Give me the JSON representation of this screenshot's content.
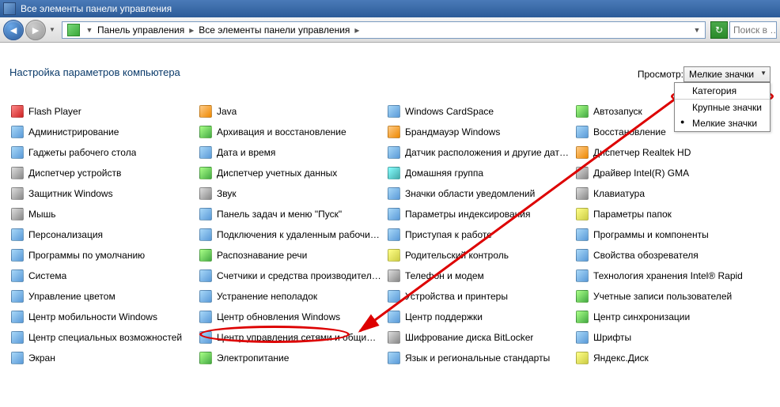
{
  "window": {
    "title": "Все элементы панели управления"
  },
  "toolbar": {
    "crumb1": "Панель управления",
    "crumb2": "Все элементы панели управления",
    "search_placeholder": "Поиск в …"
  },
  "page": {
    "title": "Настройка параметров компьютера",
    "view_label": "Просмотр:",
    "view_selected": "Мелкие значки"
  },
  "view_menu": {
    "opt1": "Категория",
    "opt2": "Крупные значки",
    "opt3": "Мелкие значки"
  },
  "items": [
    {
      "label": "Flash Player",
      "c": "c-red"
    },
    {
      "label": "Java",
      "c": "c-orange"
    },
    {
      "label": "Windows CardSpace",
      "c": ""
    },
    {
      "label": "Автозапуск",
      "c": "c-green"
    },
    {
      "label": "Администрирование",
      "c": ""
    },
    {
      "label": "Архивация и восстановление",
      "c": "c-green"
    },
    {
      "label": "Брандмауэр Windows",
      "c": "c-orange"
    },
    {
      "label": "Восстановление",
      "c": ""
    },
    {
      "label": "Гаджеты рабочего стола",
      "c": ""
    },
    {
      "label": "Дата и время",
      "c": ""
    },
    {
      "label": "Датчик расположения и другие датч…",
      "c": ""
    },
    {
      "label": "Диспетчер Realtek HD",
      "c": "c-orange"
    },
    {
      "label": "Диспетчер устройств",
      "c": "c-gray"
    },
    {
      "label": "Диспетчер учетных данных",
      "c": "c-green"
    },
    {
      "label": "Домашняя группа",
      "c": "c-teal"
    },
    {
      "label": "Драйвер Intel(R) GMA",
      "c": "c-gray"
    },
    {
      "label": "Защитник Windows",
      "c": "c-gray"
    },
    {
      "label": "Звук",
      "c": "c-gray"
    },
    {
      "label": "Значки области уведомлений",
      "c": ""
    },
    {
      "label": "Клавиатура",
      "c": "c-gray"
    },
    {
      "label": "Мышь",
      "c": "c-gray"
    },
    {
      "label": "Панель задач и меню \"Пуск\"",
      "c": ""
    },
    {
      "label": "Параметры индексирования",
      "c": ""
    },
    {
      "label": "Параметры папок",
      "c": "c-yellow"
    },
    {
      "label": "Персонализация",
      "c": ""
    },
    {
      "label": "Подключения к удаленным рабочим с…",
      "c": ""
    },
    {
      "label": "Приступая к работе",
      "c": ""
    },
    {
      "label": "Программы и компоненты",
      "c": ""
    },
    {
      "label": "Программы по умолчанию",
      "c": ""
    },
    {
      "label": "Распознавание речи",
      "c": "c-green"
    },
    {
      "label": "Родительский контроль",
      "c": "c-yellow"
    },
    {
      "label": "Свойства обозревателя",
      "c": ""
    },
    {
      "label": "Система",
      "c": ""
    },
    {
      "label": "Счетчики и средства производитель…",
      "c": ""
    },
    {
      "label": "Телефон и модем",
      "c": "c-gray"
    },
    {
      "label": "Технология хранения Intel® Rapid",
      "c": ""
    },
    {
      "label": "Управление цветом",
      "c": ""
    },
    {
      "label": "Устранение неполадок",
      "c": ""
    },
    {
      "label": "Устройства и принтеры",
      "c": ""
    },
    {
      "label": "Учетные записи пользователей",
      "c": "c-green"
    },
    {
      "label": "Центр мобильности Windows",
      "c": ""
    },
    {
      "label": "Центр обновления Windows",
      "c": ""
    },
    {
      "label": "Центр поддержки",
      "c": ""
    },
    {
      "label": "Центр синхронизации",
      "c": "c-green"
    },
    {
      "label": "Центр специальных возможностей",
      "c": ""
    },
    {
      "label": "Центр управления сетями и общим д…",
      "c": ""
    },
    {
      "label": "Шифрование диска BitLocker",
      "c": "c-gray"
    },
    {
      "label": "Шрифты",
      "c": ""
    },
    {
      "label": "Экран",
      "c": ""
    },
    {
      "label": "Электропитание",
      "c": "c-green"
    },
    {
      "label": "Язык и региональные стандарты",
      "c": ""
    },
    {
      "label": "Яндекс.Диск",
      "c": "c-yellow"
    }
  ]
}
